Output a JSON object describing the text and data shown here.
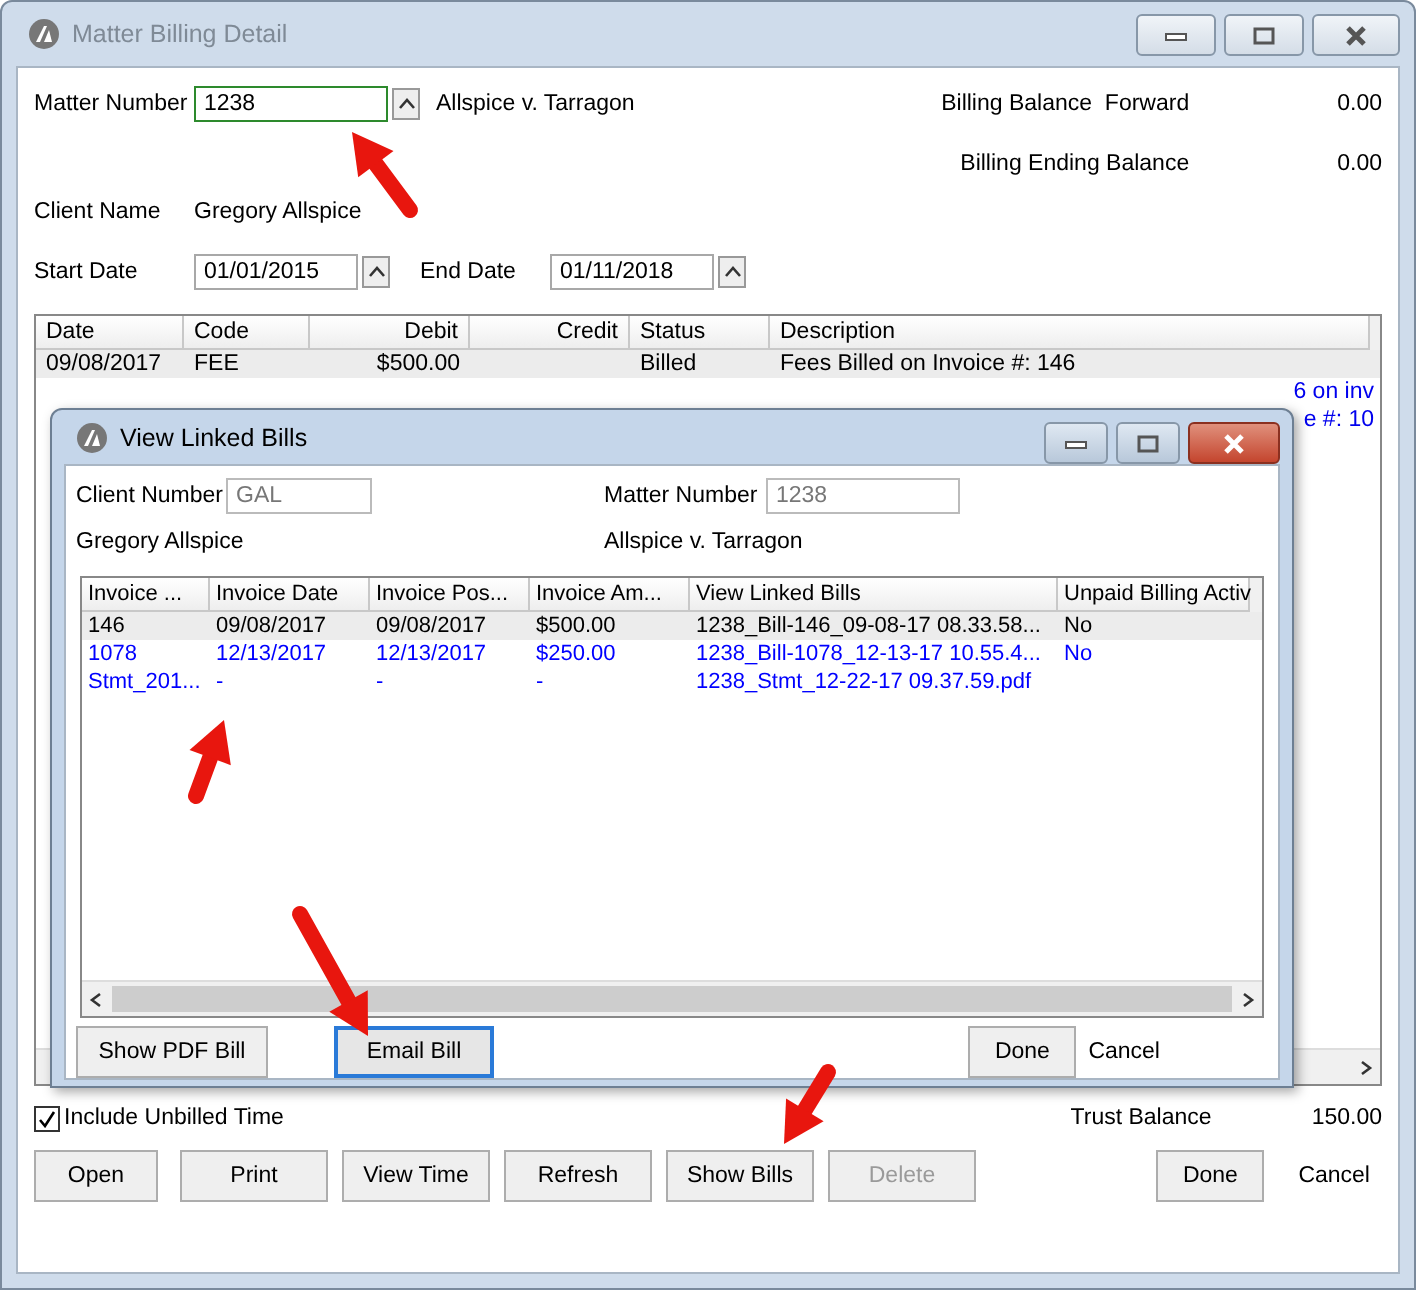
{
  "window": {
    "title": "Matter Billing Detail"
  },
  "matter_number": {
    "label": "Matter Number",
    "value": "1238",
    "matter_name": "Allspice v. Tarragon"
  },
  "client_name": {
    "label": "Client Name",
    "value": "Gregory Allspice"
  },
  "start_date": {
    "label": "Start Date",
    "value": "01/01/2015"
  },
  "end_date": {
    "label": "End Date",
    "value": "01/11/2018"
  },
  "balances": [
    {
      "label": "Billing Balance  Forward",
      "value": "0.00"
    },
    {
      "label": "Billing Ending Balance",
      "value": "0.00"
    }
  ],
  "table": {
    "columns": [
      "Date",
      "Code",
      "Debit",
      "Credit",
      "Status",
      "Description"
    ],
    "rows": [
      {
        "kind": "full",
        "selected": true,
        "cells": [
          "09/08/2017",
          "FEE",
          "$500.00",
          "",
          "Billed",
          "Fees Billed on Invoice #: 146"
        ]
      },
      {
        "kind": "partial",
        "selected": false,
        "visible_text": "6 on inv"
      },
      {
        "kind": "partial",
        "selected": false,
        "visible_text": "e #: 10"
      }
    ]
  },
  "include_unbilled_time": {
    "label": "Include Unbilled Time",
    "checked": true
  },
  "trust_balance": {
    "label": "Trust Balance",
    "value": "150.00"
  },
  "buttons": [
    {
      "label": "Open",
      "disabled": false
    },
    {
      "label": "Print",
      "disabled": false
    },
    {
      "label": "View Time",
      "disabled": false
    },
    {
      "label": "Refresh",
      "disabled": false
    },
    {
      "label": "Show Bills",
      "disabled": false
    },
    {
      "label": "Delete",
      "disabled": true
    }
  ],
  "done_button": {
    "label": "Done"
  },
  "cancel_link": {
    "label": "Cancel"
  },
  "dialog": {
    "title": "View Linked Bills",
    "client_number": {
      "label": "Client Number",
      "value": "GAL"
    },
    "matter_number": {
      "label": "Matter Number",
      "value": "1238"
    },
    "client_name": "Gregory Allspice",
    "matter_name": "Allspice v. Tarragon",
    "columns": [
      "Invoice ...",
      "Invoice Date",
      "Invoice Pos...",
      "Invoice Am...",
      "View Linked Bills",
      "Unpaid Billing Activ"
    ],
    "rows": [
      {
        "selected": true,
        "color": "#000000",
        "cells": [
          "146",
          "09/08/2017",
          "09/08/2017",
          "$500.00",
          "1238_Bill-146_09-08-17 08.33.58...",
          "No"
        ]
      },
      {
        "selected": false,
        "color": "#0000ff",
        "cells": [
          "1078",
          "12/13/2017",
          "12/13/2017",
          "$250.00",
          "1238_Bill-1078_12-13-17 10.55.4...",
          "No"
        ]
      },
      {
        "selected": false,
        "color": "#0000ff",
        "cells": [
          "Stmt_201...",
          "-",
          "-",
          "-",
          "1238_Stmt_12-22-17 09.37.59.pdf",
          ""
        ]
      }
    ],
    "buttons": [
      {
        "label": "Show PDF Bill",
        "focused": false
      },
      {
        "label": "Email Bill",
        "focused": true
      }
    ],
    "done_button": {
      "label": "Done"
    },
    "cancel_link": {
      "label": "Cancel"
    }
  }
}
